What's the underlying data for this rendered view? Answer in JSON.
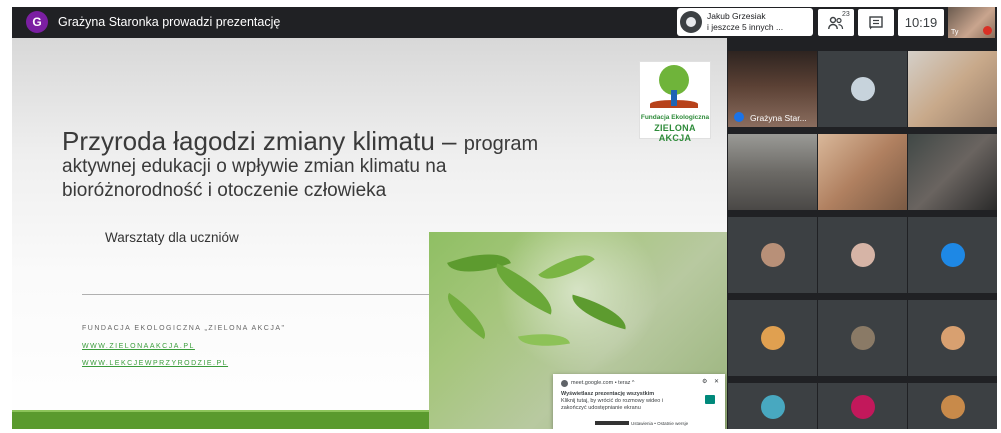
{
  "topbar": {
    "presenter_initial": "G",
    "presenter_text": "Grażyna Staronka prowadzi prezentację",
    "speaker_line1": "Jakub Grzesiak",
    "speaker_line2": "i jeszcze 5 innych ...",
    "people_count": "23",
    "clock": "10:19",
    "self_label": "Ty"
  },
  "slide": {
    "title_main": "Przyroda łagodzi zmiany klimatu – ",
    "title_small": "program",
    "subtitle_line1": "aktywnej edukacji o wpływie zmian klimatu na",
    "subtitle_line2": "bioróżnorodność i otoczenie człowieka",
    "workshop": "Warsztaty dla uczniów",
    "foundation": "FUNDACJA EKOLOGICZNA „ZIELONA AKCJA\"",
    "link1": "WWW.ZIELONAAKCJA.PL",
    "link2": "WWW.LEKCJEWPRZYRODZIE.PL",
    "logo_line1": "Fundacja Ekologiczna",
    "logo_line2": "ZIELONA AKCJA"
  },
  "notification": {
    "source": "meet.google.com • teraz ^",
    "heading": "Wyświetlasz prezentację wszystkim",
    "body1": "Kliknij tutaj, by wrócić do rozmowy wideo i",
    "body2": "zakończyć udostępnianie ekranu",
    "footer": "Ustawienia • Ostatnie wersje"
  },
  "grid": {
    "tiles": [
      {
        "name": "Grażyna Star...",
        "type": "video"
      },
      {
        "name": "",
        "type": "avatar"
      },
      {
        "name": "",
        "type": "video"
      },
      {
        "name": "",
        "type": "video"
      },
      {
        "name": "",
        "type": "video"
      },
      {
        "name": "",
        "type": "video"
      },
      {
        "name": "",
        "type": "avatar"
      },
      {
        "name": "",
        "type": "avatar"
      },
      {
        "name": "",
        "type": "avatar"
      },
      {
        "name": "",
        "type": "avatar"
      },
      {
        "name": "",
        "type": "avatar"
      },
      {
        "name": "",
        "type": "avatar"
      },
      {
        "name": "",
        "type": "avatar"
      },
      {
        "name": "",
        "type": "avatar"
      },
      {
        "name": "",
        "type": "avatar"
      }
    ]
  },
  "colors": {
    "presenter_avatar": "#7b1fa2",
    "accent_green": "#5a9a2e",
    "meet_dark": "#202124",
    "tile_bg": "#3c4043"
  }
}
